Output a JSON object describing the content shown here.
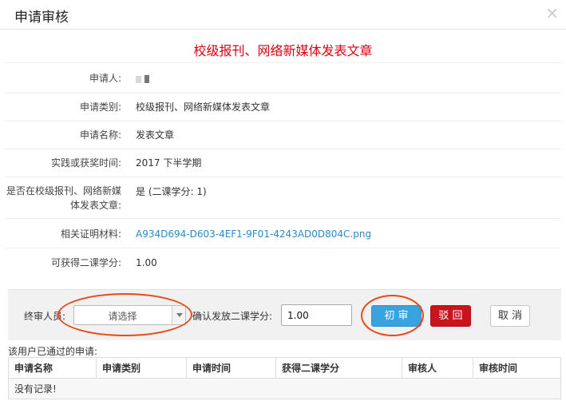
{
  "dialog": {
    "title": "申请审核",
    "close_icon": "×"
  },
  "heading": "校级报刊、网络新媒体发表文章",
  "details": [
    {
      "label": "申请人:",
      "value": ""
    },
    {
      "label": "申请类别:",
      "value": "校级报刊、网络新媒体发表文章"
    },
    {
      "label": "申请名称:",
      "value": "发表文章"
    },
    {
      "label": "实践或获奖时间:",
      "value": "2017 下半学期"
    },
    {
      "label_line1": "是否在校级报刊、网络新媒",
      "label_line2": "体发表文章:",
      "value": "是 (二课学分: 1)"
    },
    {
      "label": "相关证明材料:",
      "value": "A934D694-D603-4EF1-9F01-4243AD0D804C.png"
    },
    {
      "label": "可获得二课学分:",
      "value": "1.00"
    }
  ],
  "actions": {
    "final_reviewer_label": "终审人员:",
    "final_reviewer_selected": "请选择",
    "confirm_credit_label": "确认发放二课学分:",
    "confirm_credit_value": "1.00",
    "first_review_button": "初 审",
    "reject_button": "驳 回",
    "cancel_button": "取 消"
  },
  "history": {
    "title": "该用户已通过的申请:",
    "columns": [
      "申请名称",
      "申请类别",
      "申请时间",
      "获得二课学分",
      "审核人",
      "审核时间"
    ],
    "empty_text": "没有记录!"
  },
  "colors": {
    "heading": "#d9000f",
    "primary_button": "#39a3e0",
    "danger_button": "#c9141e",
    "annotation_ellipse": "#e84a1a",
    "link": "#2a8ac5"
  }
}
